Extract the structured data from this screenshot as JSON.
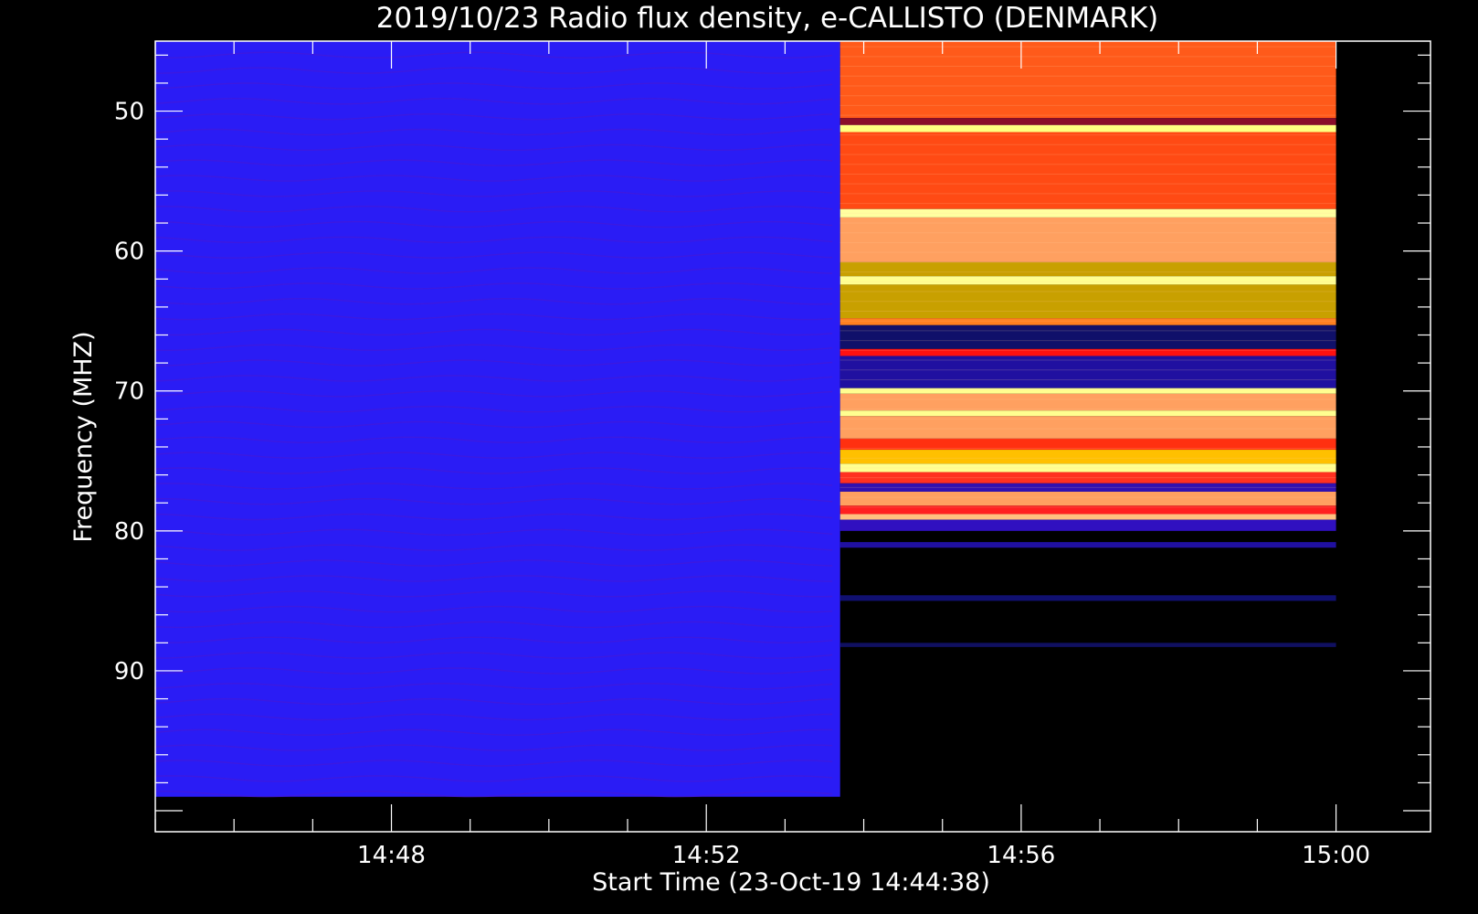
{
  "chart_data": {
    "type": "heatmap",
    "title": "2019/10/23  Radio flux density, e-CALLISTO (DENMARK)",
    "xlabel": "Start Time (23-Oct-19 14:44:38)",
    "ylabel": "Frequency (MHZ)",
    "x_range_minutes": [
      14.74,
      15.0
    ],
    "x_data_range_minutes": [
      14.74,
      15.0
    ],
    "ylim": [
      45,
      100
    ],
    "y_data_range": [
      45,
      99
    ],
    "y_inverted": true,
    "x_ticks": [
      {
        "value": 48,
        "label": "14:48"
      },
      {
        "value": 52,
        "label": "14:52"
      },
      {
        "value": 56,
        "label": "14:56"
      },
      {
        "value": 60,
        "label": "15:00"
      }
    ],
    "y_ticks": [
      {
        "value": 50,
        "label": "50"
      },
      {
        "value": 60,
        "label": "60"
      },
      {
        "value": 70,
        "label": "70"
      },
      {
        "value": 80,
        "label": "80"
      },
      {
        "value": 90,
        "label": "90"
      }
    ],
    "segments": [
      {
        "t_start": 45.0,
        "t_end": 53.7,
        "f_start": 45,
        "f_end": 99,
        "level": "low",
        "color": "#2a1cf5"
      },
      {
        "t_start": 53.7,
        "t_end": 60.0,
        "f_start": 45,
        "f_end": 81,
        "level": "high",
        "color": "#ff5a1a"
      }
    ],
    "bands_segment2": [
      {
        "f0": 45.0,
        "f1": 50.5,
        "color": "#ff5a1a"
      },
      {
        "f0": 50.5,
        "f1": 51.0,
        "color": "#8a0d2a"
      },
      {
        "f0": 51.0,
        "f1": 51.5,
        "color": "#ffff80"
      },
      {
        "f0": 51.5,
        "f1": 57.0,
        "color": "#ff4a14"
      },
      {
        "f0": 57.0,
        "f1": 57.6,
        "color": "#ffffa0"
      },
      {
        "f0": 57.6,
        "f1": 60.8,
        "color": "#ffa060"
      },
      {
        "f0": 60.8,
        "f1": 61.8,
        "color": "#c8a000"
      },
      {
        "f0": 61.8,
        "f1": 62.4,
        "color": "#ffff90"
      },
      {
        "f0": 62.4,
        "f1": 64.8,
        "color": "#c8a000"
      },
      {
        "f0": 64.8,
        "f1": 65.3,
        "color": "#ff8020"
      },
      {
        "f0": 65.3,
        "f1": 67.0,
        "color": "#10106a"
      },
      {
        "f0": 67.0,
        "f1": 67.5,
        "color": "#ff1010"
      },
      {
        "f0": 67.5,
        "f1": 69.8,
        "color": "#2010a0"
      },
      {
        "f0": 69.8,
        "f1": 70.2,
        "color": "#ffff90"
      },
      {
        "f0": 70.2,
        "f1": 71.4,
        "color": "#ffa060"
      },
      {
        "f0": 71.4,
        "f1": 71.8,
        "color": "#ffff90"
      },
      {
        "f0": 71.8,
        "f1": 73.4,
        "color": "#ffa060"
      },
      {
        "f0": 73.4,
        "f1": 74.2,
        "color": "#ff3010"
      },
      {
        "f0": 74.2,
        "f1": 75.2,
        "color": "#ffc000"
      },
      {
        "f0": 75.2,
        "f1": 75.8,
        "color": "#ffff90"
      },
      {
        "f0": 75.8,
        "f1": 76.6,
        "color": "#ff3020"
      },
      {
        "f0": 76.6,
        "f1": 77.2,
        "color": "#3010b0"
      },
      {
        "f0": 77.2,
        "f1": 78.2,
        "color": "#ffa060"
      },
      {
        "f0": 78.2,
        "f1": 78.8,
        "color": "#ff2020"
      },
      {
        "f0": 78.8,
        "f1": 79.2,
        "color": "#ffc080"
      },
      {
        "f0": 79.2,
        "f1": 80.0,
        "color": "#3010c0"
      },
      {
        "f0": 80.8,
        "f1": 81.2,
        "color": "#2010a0"
      },
      {
        "f0": 84.6,
        "f1": 85.0,
        "color": "#101070"
      },
      {
        "f0": 88.0,
        "f1": 88.3,
        "color": "#101060"
      }
    ],
    "colors": {
      "background": "#000000",
      "axes": "#ffffff",
      "low_flux": "#2a1cf5",
      "high_flux": "#ff5a1a"
    },
    "grid": false
  }
}
